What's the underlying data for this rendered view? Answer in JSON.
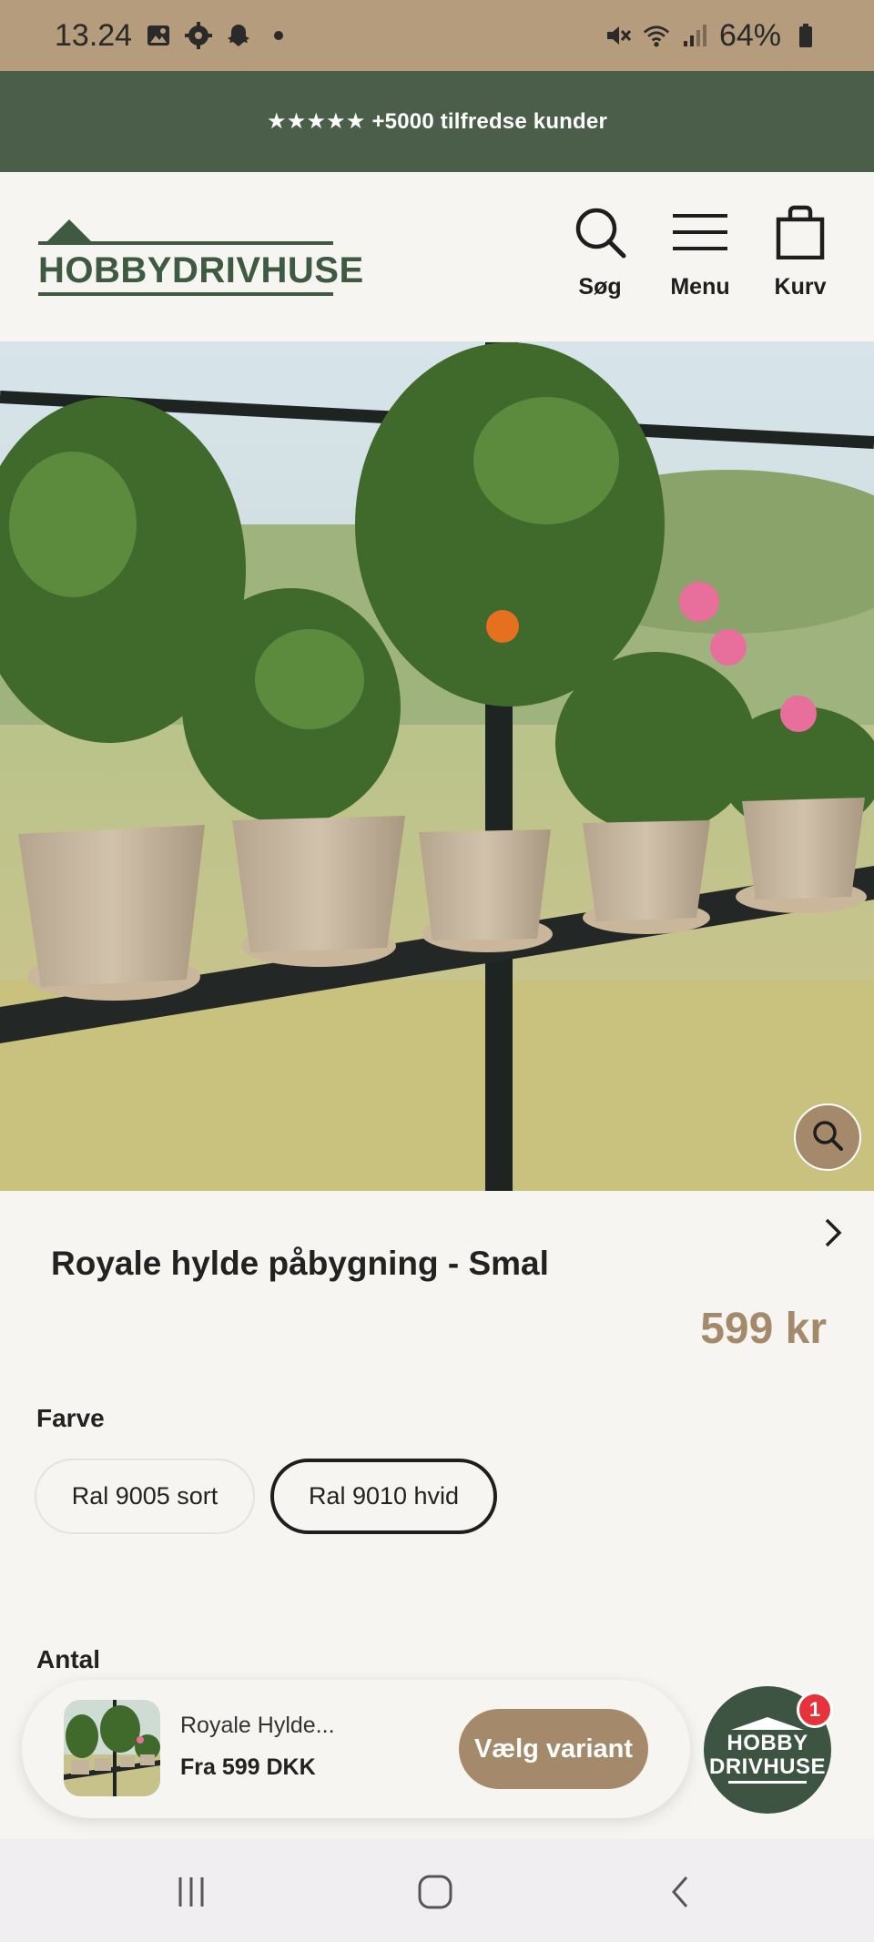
{
  "status_bar": {
    "time": "13.24",
    "battery": "64%",
    "left_icons": [
      "gallery-icon",
      "settings-gear-icon",
      "snapchat-icon",
      "dot-icon"
    ],
    "right_icons": [
      "mute-icon",
      "wifi-icon",
      "signal-icon",
      "battery-icon"
    ]
  },
  "announcement": {
    "text": "★★★★★ +5000 tilfredse kunder"
  },
  "header": {
    "logo_text": "HOBBYDRIVHUSE",
    "search_label": "Søg",
    "menu_label": "Menu",
    "cart_label": "Kurv"
  },
  "product": {
    "title": "Royale hylde påbygning - Smal",
    "price": "599 kr",
    "color_label": "Farve",
    "variants": [
      {
        "label": "Ral 9005 sort",
        "selected": false
      },
      {
        "label": "Ral 9010 hvid",
        "selected": true
      }
    ],
    "quantity_label": "Antal"
  },
  "sticky_bar": {
    "name": "Royale Hylde...",
    "price": "Fra 599 DKK",
    "cta": "Vælg variant"
  },
  "chat": {
    "line1": "HOBBY",
    "line2": "DRIVHUSE",
    "badge": "1"
  },
  "colors": {
    "status_bar": "#b59c7c",
    "announcement_bg": "#4b5e4a",
    "brand_green": "#3e5a40",
    "accent_brown": "#a48a6b",
    "badge_red": "#e5323b"
  }
}
